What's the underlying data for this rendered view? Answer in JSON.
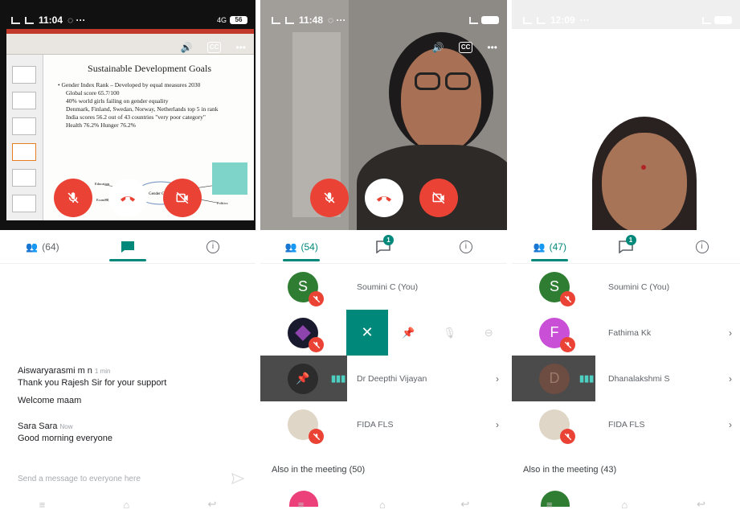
{
  "panel1": {
    "status_time": "11:04",
    "status_icons": "4G",
    "battery": "56",
    "slide": {
      "title": "Sustainable Development Goals",
      "lines": [
        "• Gender Index Rank – Developed by equal measures 2030",
        "Global score 65.7/100",
        "40% world girls failing on gender equality",
        "Denmark, Finland, Swedan, Norway, Netherlands top 5 in rank",
        "India scores 56.2 out of 43 countries \"very poor category\"",
        "Health 76.2% Hunger 76.2%"
      ],
      "diagram_center": "Gender Gap of",
      "diagram_left_top": "Education",
      "diagram_left_bottom": "Economy",
      "diagram_right_top": "Health",
      "diagram_right_bottom": "Politics"
    },
    "tabs": {
      "people_count": "(64)"
    },
    "messages": [
      {
        "sender": "Aiswaryarasmi m n",
        "time": "1 min",
        "texts": [
          "Thank you Rajesh Sir for your support",
          "Welcome maam"
        ]
      },
      {
        "sender": "Sara Sara",
        "time": "Now",
        "texts": [
          "Good morning everyone"
        ]
      }
    ],
    "send_placeholder": "Send a message to everyone here"
  },
  "panel2": {
    "status_time": "11:48",
    "tabs": {
      "people_count": "(54)",
      "chat_badge": "1"
    },
    "participants": [
      {
        "initial": "S",
        "name": "Soumini C (You)",
        "color": "#2e7d32"
      },
      {
        "initial": "",
        "name": "",
        "color": "#1a1a2e"
      },
      {
        "initial": "",
        "name": "Dr Deepthi Vijayan",
        "color": "#4b4b4b"
      },
      {
        "initial": "",
        "name": "FIDA FLS",
        "color": "#e0d6c8"
      }
    ],
    "also_in_meeting": "Also in the meeting (50)"
  },
  "panel3": {
    "status_time": "12:09",
    "tabs": {
      "people_count": "(47)",
      "chat_badge": "1"
    },
    "participants": [
      {
        "initial": "S",
        "name": "Soumini C (You)",
        "color": "#2e7d32"
      },
      {
        "initial": "F",
        "name": "Fathima Kk",
        "color": "#c84fd6"
      },
      {
        "initial": "D",
        "name": "Dhanalakshmi S",
        "color": "#6d4c41"
      },
      {
        "initial": "",
        "name": "FIDA FLS",
        "color": "#e0d6c8"
      }
    ],
    "also_in_meeting": "Also in the meeting (43)"
  },
  "colors": {
    "accent": "#00897b",
    "danger": "#ea4335"
  },
  "icons": [
    "mic-off-icon",
    "end-call-icon",
    "camera-off-icon",
    "people-icon",
    "chat-icon",
    "info-icon",
    "speaker-icon",
    "captions-icon",
    "more-icon",
    "pin-icon",
    "close-icon",
    "send-icon",
    "chevron-right-icon"
  ]
}
